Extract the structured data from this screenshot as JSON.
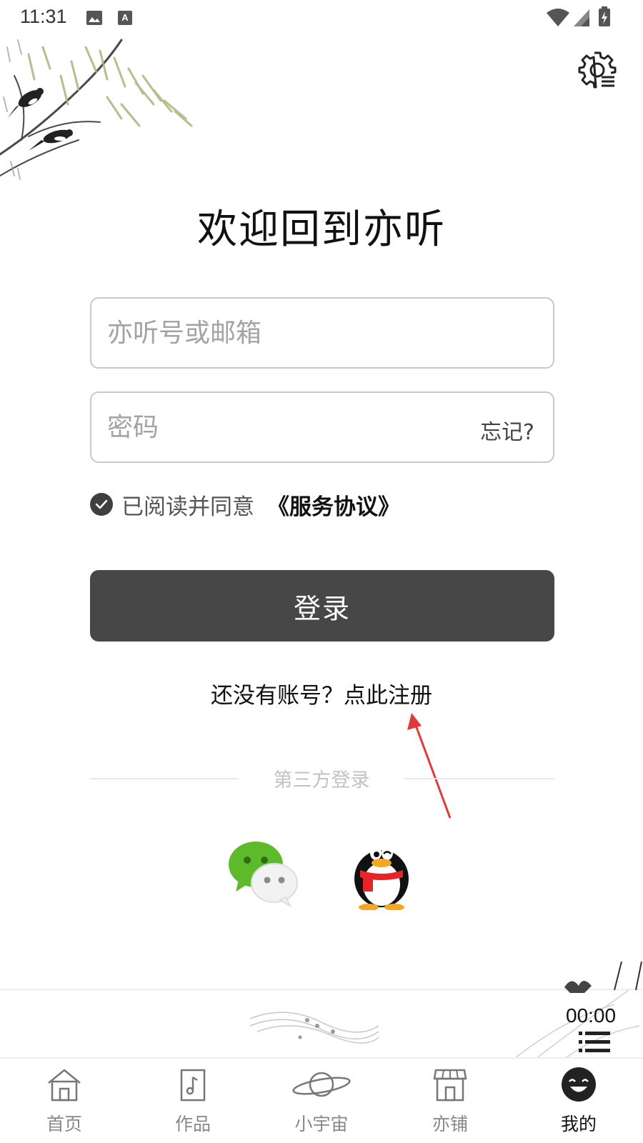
{
  "status_bar": {
    "time": "11:31",
    "icons": [
      "gallery-icon",
      "keyboard-a-icon",
      "wifi-icon",
      "signal-icon",
      "battery-charging-icon"
    ]
  },
  "header": {
    "settings_icon": "settings-gear-icon"
  },
  "title": "欢迎回到亦听",
  "form": {
    "account_placeholder": "亦听号或邮箱",
    "account_value": "",
    "password_placeholder": "密码",
    "password_value": "",
    "forgot_label": "忘记?",
    "agree_text": "已阅读并同意",
    "agreement_link": "《服务协议》",
    "agree_checked": true,
    "login_label": "登录"
  },
  "register_text": "还没有账号？点此注册",
  "third_party": {
    "label": "第三方登录",
    "providers": [
      "wechat-icon",
      "qq-icon"
    ]
  },
  "player": {
    "time": "00:00",
    "playlist_icon": "playlist-icon"
  },
  "tabs": [
    {
      "label": "首页",
      "icon": "home-icon",
      "active": false
    },
    {
      "label": "作品",
      "icon": "music-file-icon",
      "active": false
    },
    {
      "label": "小宇宙",
      "icon": "planet-icon",
      "active": false
    },
    {
      "label": "亦铺",
      "icon": "store-icon",
      "active": false
    },
    {
      "label": "我的",
      "icon": "smiley-avatar-icon",
      "active": true
    }
  ],
  "colors": {
    "primary_button": "#474747",
    "annotation_arrow": "#e03a3a",
    "wechat_green": "#5dbb2b",
    "qq_scarf_red": "#e8242b"
  }
}
